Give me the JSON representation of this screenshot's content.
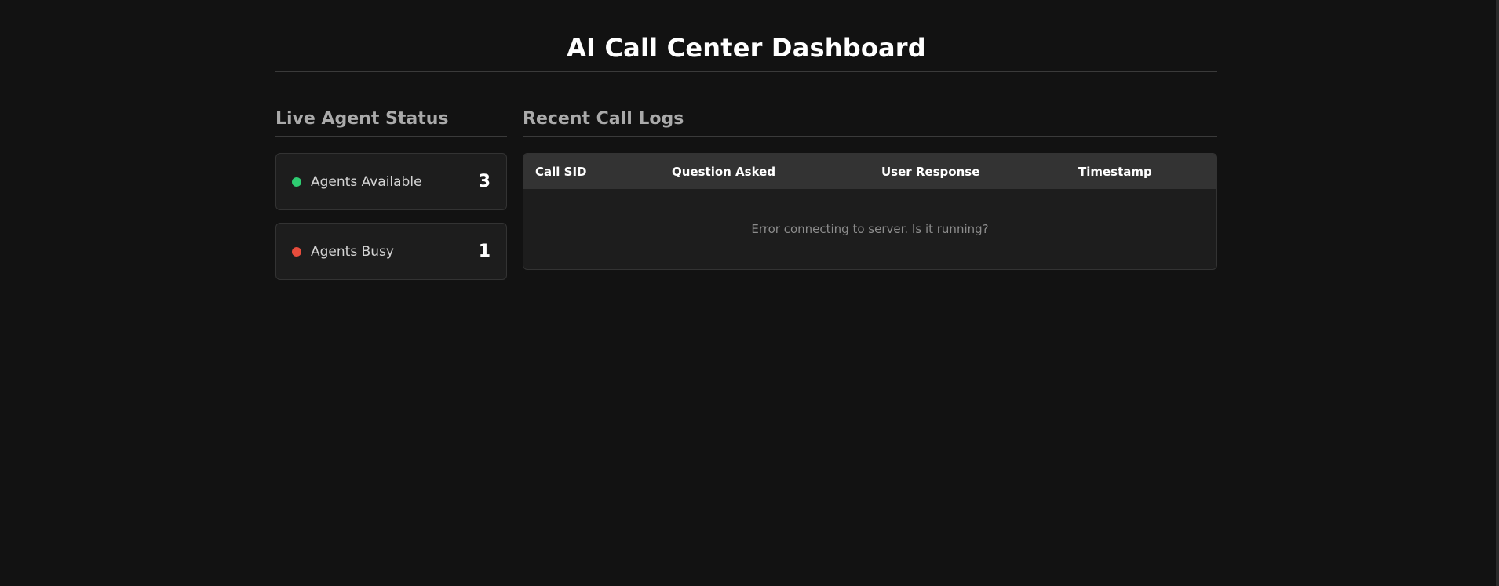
{
  "header": {
    "title": "AI Call Center Dashboard"
  },
  "agent_status": {
    "title": "Live Agent Status",
    "cards": [
      {
        "label": "Agents Available",
        "count": "3",
        "indicator_color": "#2ecc71"
      },
      {
        "label": "Agents Busy",
        "count": "1",
        "indicator_color": "#e74c3c"
      }
    ]
  },
  "call_logs": {
    "title": "Recent Call Logs",
    "columns": [
      "Call SID",
      "Question Asked",
      "User Response",
      "Timestamp"
    ],
    "message": "Error connecting to server. Is it running?"
  }
}
